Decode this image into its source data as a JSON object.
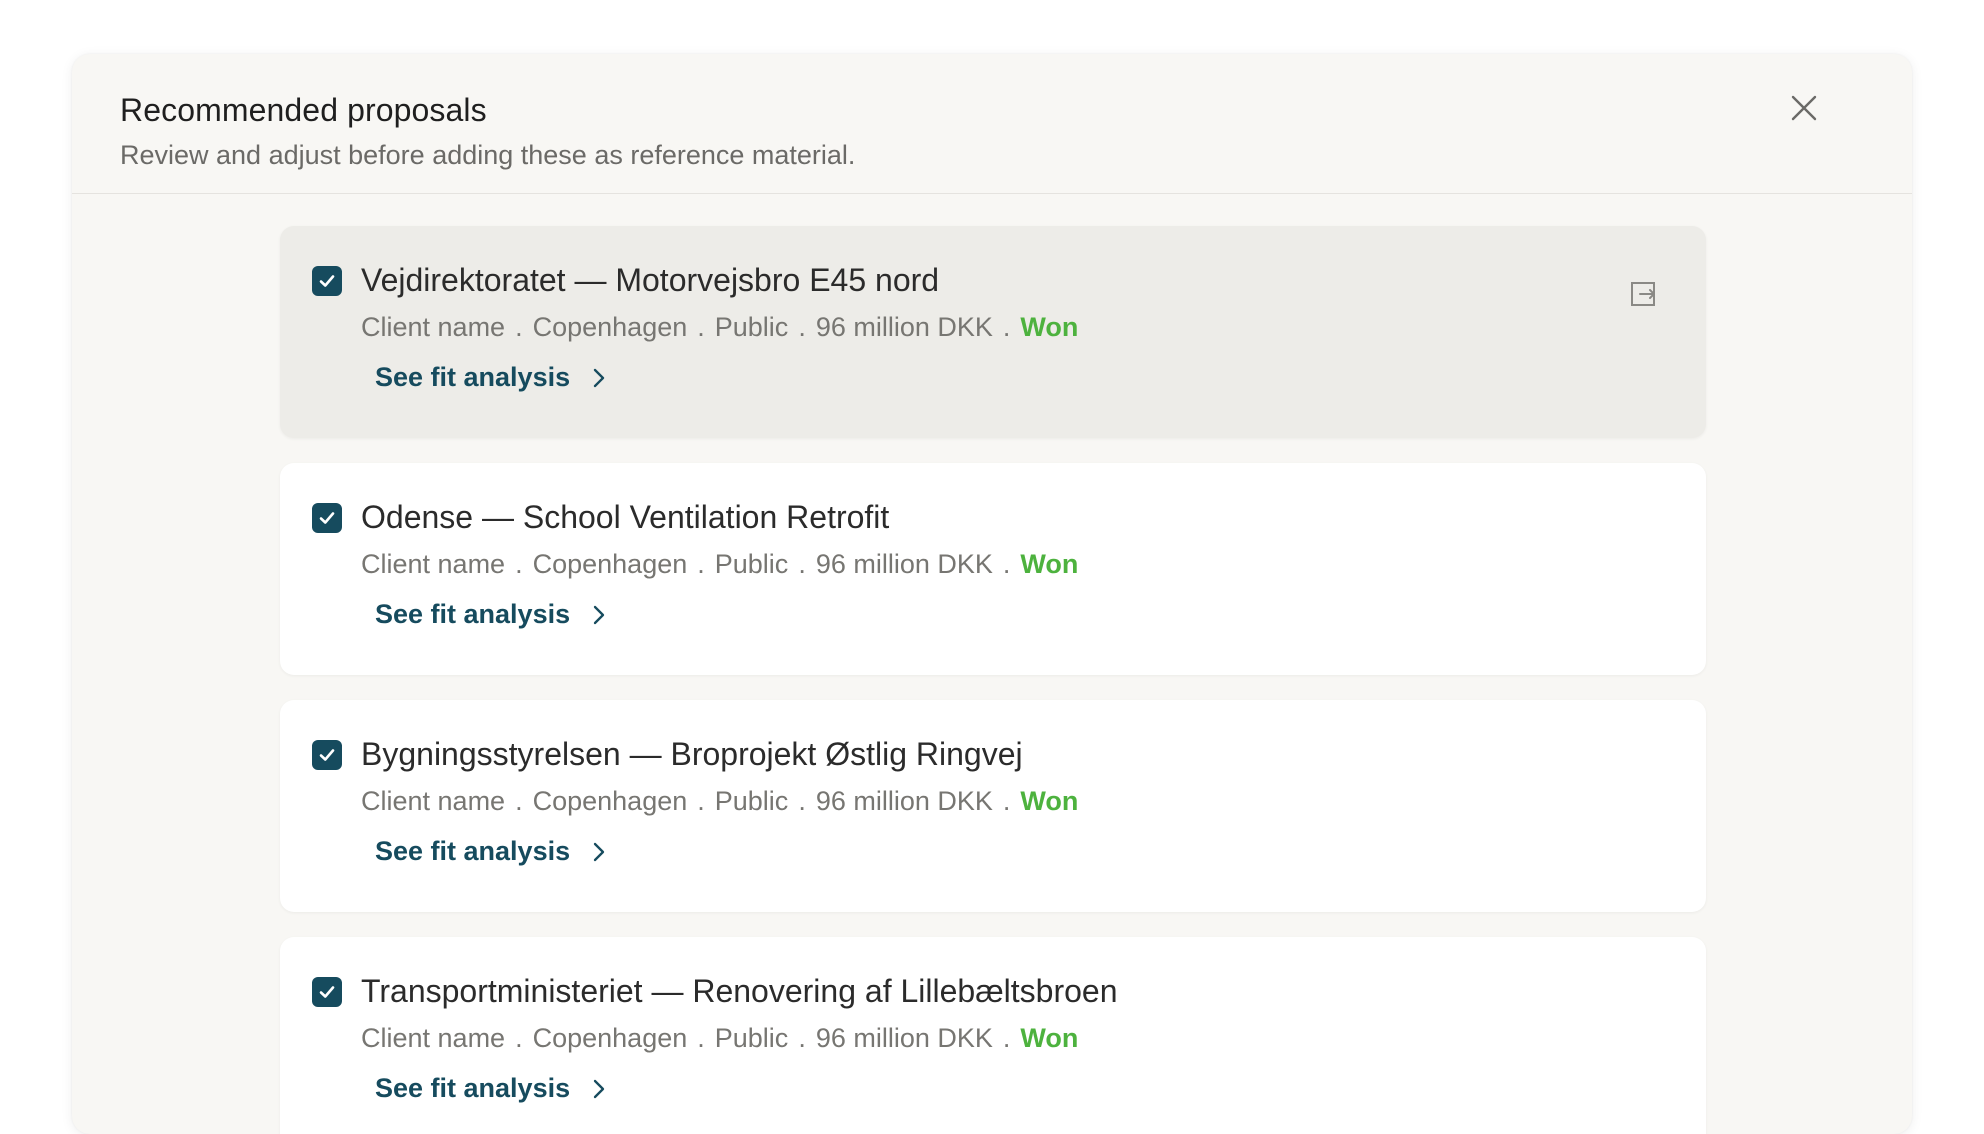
{
  "modal": {
    "title": "Recommended proposals",
    "subtitle": "Review and adjust before adding these as reference material.",
    "close_icon": "close-icon"
  },
  "proposals": [
    {
      "title": "Vejdirektoratet — Motorvejsbro E45 nord",
      "client": "Client name",
      "location": "Copenhagen",
      "sector": "Public",
      "value": "96 million DKK",
      "status": "Won",
      "link": "See fit analysis",
      "checked": true
    },
    {
      "title": "Odense — School Ventilation Retrofit",
      "client": "Client name",
      "location": "Copenhagen",
      "sector": "Public",
      "value": "96 million DKK",
      "status": "Won",
      "link": "See fit analysis",
      "checked": true
    },
    {
      "title": "Bygningsstyrelsen — Broprojekt Østlig Ringvej",
      "client": "Client name",
      "location": "Copenhagen",
      "sector": "Public",
      "value": "96 million DKK",
      "status": "Won",
      "link": "See fit analysis",
      "checked": true
    },
    {
      "title": "Transportministeriet — Renovering af Lillebæltsbroen",
      "client": "Client name",
      "location": "Copenhagen",
      "sector": "Public",
      "value": "96 million DKK",
      "status": "Won",
      "link": "See fit analysis",
      "checked": true
    }
  ],
  "meta_separator": ".",
  "colors": {
    "accent": "#164b5e",
    "status_won": "#4db23e",
    "card_hover": "#edece8"
  }
}
